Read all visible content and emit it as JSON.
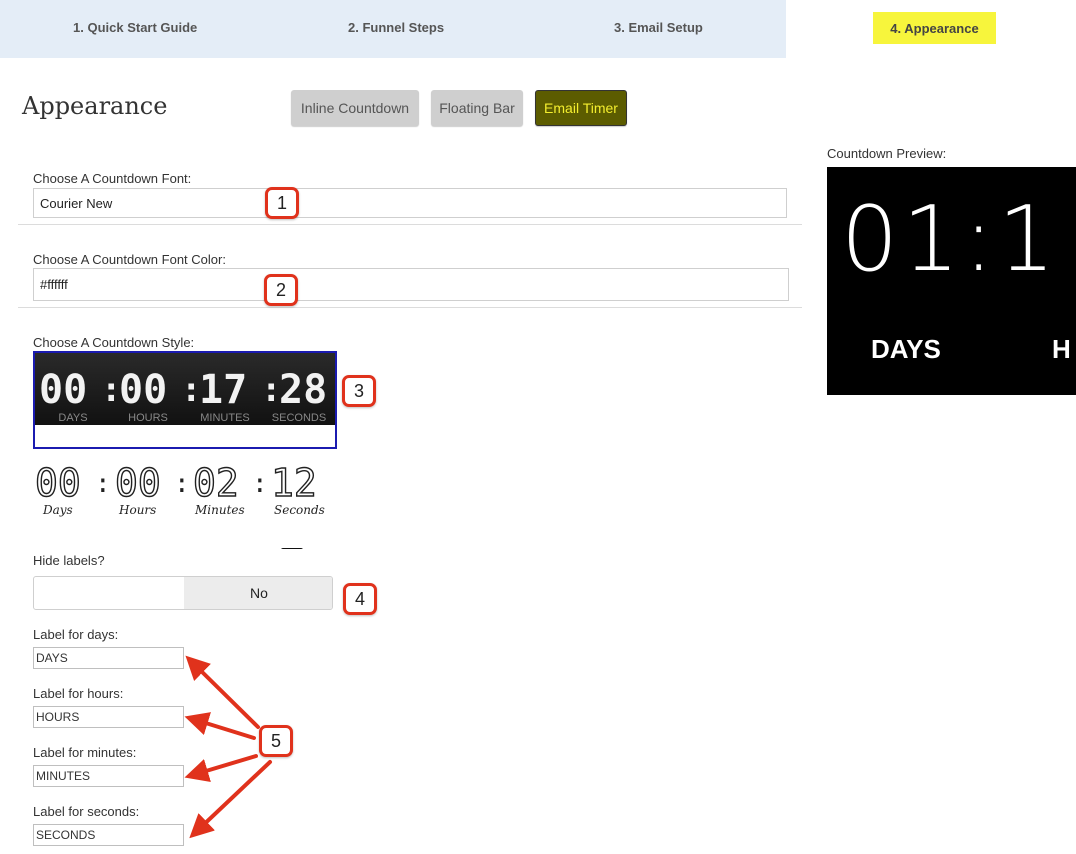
{
  "tabs": [
    {
      "label": "1. Quick Start Guide"
    },
    {
      "label": "2. Funnel Steps"
    },
    {
      "label": "3. Email Setup"
    },
    {
      "label": "4. Appearance"
    }
  ],
  "page": {
    "title": "Appearance"
  },
  "modes": [
    {
      "label": "Inline Countdown"
    },
    {
      "label": "Floating Bar"
    },
    {
      "label": "Email Timer"
    }
  ],
  "font_field": {
    "label": "Choose A Countdown Font:",
    "value": "Courier New"
  },
  "color_field": {
    "label": "Choose A Countdown Font Color:",
    "value": "#ffffff"
  },
  "style_field": {
    "label": "Choose A Countdown Style:"
  },
  "style1": {
    "digits": [
      "00",
      "00",
      "17",
      "28"
    ],
    "labels": [
      "DAYS",
      "HOURS",
      "MINUTES",
      "SECONDS"
    ]
  },
  "style2": {
    "digits": [
      "00",
      "00",
      "02",
      "12"
    ],
    "labels": [
      "Days",
      "Hours",
      "Minutes",
      "Seconds"
    ]
  },
  "hide_labels": {
    "label": "Hide labels?",
    "value": "No"
  },
  "labels": [
    {
      "label": "Label for days:",
      "value": "DAYS"
    },
    {
      "label": "Label for hours:",
      "value": "HOURS"
    },
    {
      "label": "Label for minutes:",
      "value": "MINUTES"
    },
    {
      "label": "Label for seconds:",
      "value": "SECONDS"
    }
  ],
  "preview": {
    "label": "Countdown Preview:",
    "digits": "01:1",
    "days_label": "DAYS",
    "next_label": "H"
  },
  "annotations": [
    "1",
    "2",
    "3",
    "4",
    "5"
  ],
  "colors": {
    "accent_yellow": "#f7f53c",
    "tab_bg": "#e4edf7",
    "annotation_red": "#e0321c",
    "active_btn": "#5c5c00"
  }
}
